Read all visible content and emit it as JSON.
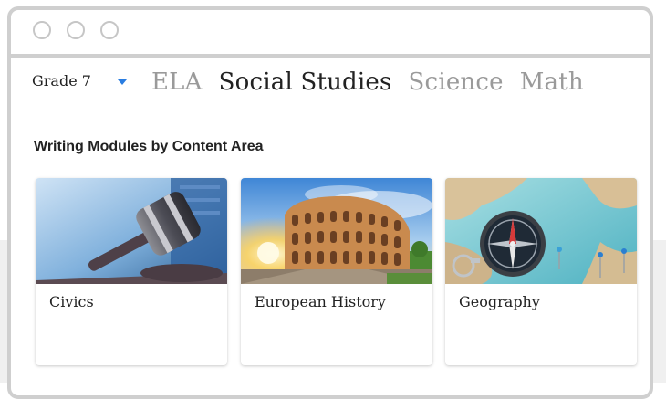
{
  "grade_select": {
    "value": "Grade 7"
  },
  "subject_tabs": [
    {
      "label": "ELA",
      "active": false
    },
    {
      "label": "Social Studies",
      "active": true
    },
    {
      "label": "Science",
      "active": false
    },
    {
      "label": "Math",
      "active": false
    }
  ],
  "section": {
    "heading": "Writing Modules by Content Area"
  },
  "cards": [
    {
      "title": "Civics",
      "image": "gavel-image"
    },
    {
      "title": "European History",
      "image": "colosseum-image"
    },
    {
      "title": "Geography",
      "image": "compass-map-image"
    }
  ],
  "colors": {
    "accent": "#2a7de1",
    "active_tab": "#222222",
    "inactive_tab": "#9a9a9a",
    "window_border": "#cfcfcf"
  }
}
